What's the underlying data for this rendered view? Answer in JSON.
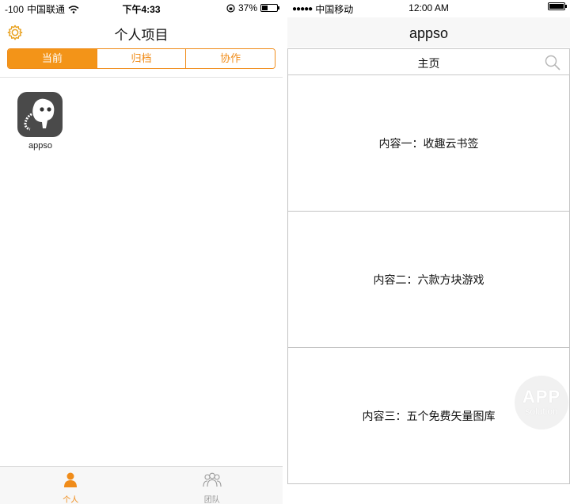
{
  "left": {
    "status": {
      "signal": "-100",
      "carrier": "中国联通",
      "time": "下午4:33",
      "battery": "37%"
    },
    "title": "个人项目",
    "segments": [
      {
        "label": "当前",
        "active": true
      },
      {
        "label": "归档",
        "active": false
      },
      {
        "label": "协作",
        "active": false
      }
    ],
    "app": {
      "name": "appso"
    },
    "tabs": [
      {
        "label": "个人",
        "icon": "person-icon",
        "active": true
      },
      {
        "label": "团队",
        "icon": "team-icon",
        "active": false
      }
    ],
    "accent": "#f39418",
    "battery_level": 0.37
  },
  "right": {
    "status": {
      "carrier": "中国移动",
      "time": "12:00 AM"
    },
    "title": "appso",
    "nav_label": "主页",
    "rows": [
      {
        "text": "内容一：收趣云书签"
      },
      {
        "text": "内容二：六款方块游戏"
      },
      {
        "text": "内容三：五个免费矢量图库"
      }
    ],
    "watermark": {
      "line1": "APP",
      "line2": "solution"
    }
  }
}
